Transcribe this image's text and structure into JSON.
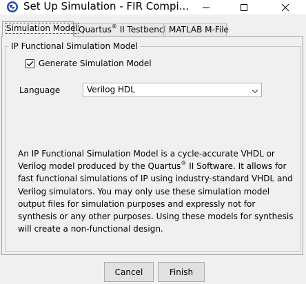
{
  "window": {
    "title": "Set Up Simulation - FIR Compi...",
    "icon": "app-logo-icon",
    "controls": [
      "minimize-icon",
      "maximize-icon",
      "close-icon"
    ]
  },
  "tabs": [
    {
      "label_pre": "Simulation Model",
      "label_sup": "",
      "label_post": "",
      "active": true
    },
    {
      "label_pre": "Quartus",
      "label_sup": "®",
      "label_post": " II Testbench",
      "active": false
    },
    {
      "label_pre": "MATLAB M-File",
      "label_sup": "",
      "label_post": "",
      "active": false
    }
  ],
  "group": {
    "title": "IP Functional Simulation Model",
    "checkbox": {
      "label": "Generate Simulation Model",
      "checked": true
    },
    "language": {
      "label": "Language",
      "selected": "Verilog HDL"
    },
    "description": {
      "part1": "An IP Functional Simulation Model is a cycle-accurate VHDL or Verilog model produced by the Quartus",
      "sup": "®",
      "part2": " II Software. It allows for fast functional simulations of IP using industry-standard VHDL and Verilog simulators. You may only use these simulation model output files for simulation purposes and expressly not for synthesis or any other purposes. Using these models for synthesis will create a non-functional design."
    }
  },
  "buttons": {
    "cancel": "Cancel",
    "finish": "Finish"
  },
  "colors": {
    "logo_blue": "#1f4aa8",
    "window_bg": "#f0f0f0",
    "button_bg": "#e1e1e1"
  }
}
